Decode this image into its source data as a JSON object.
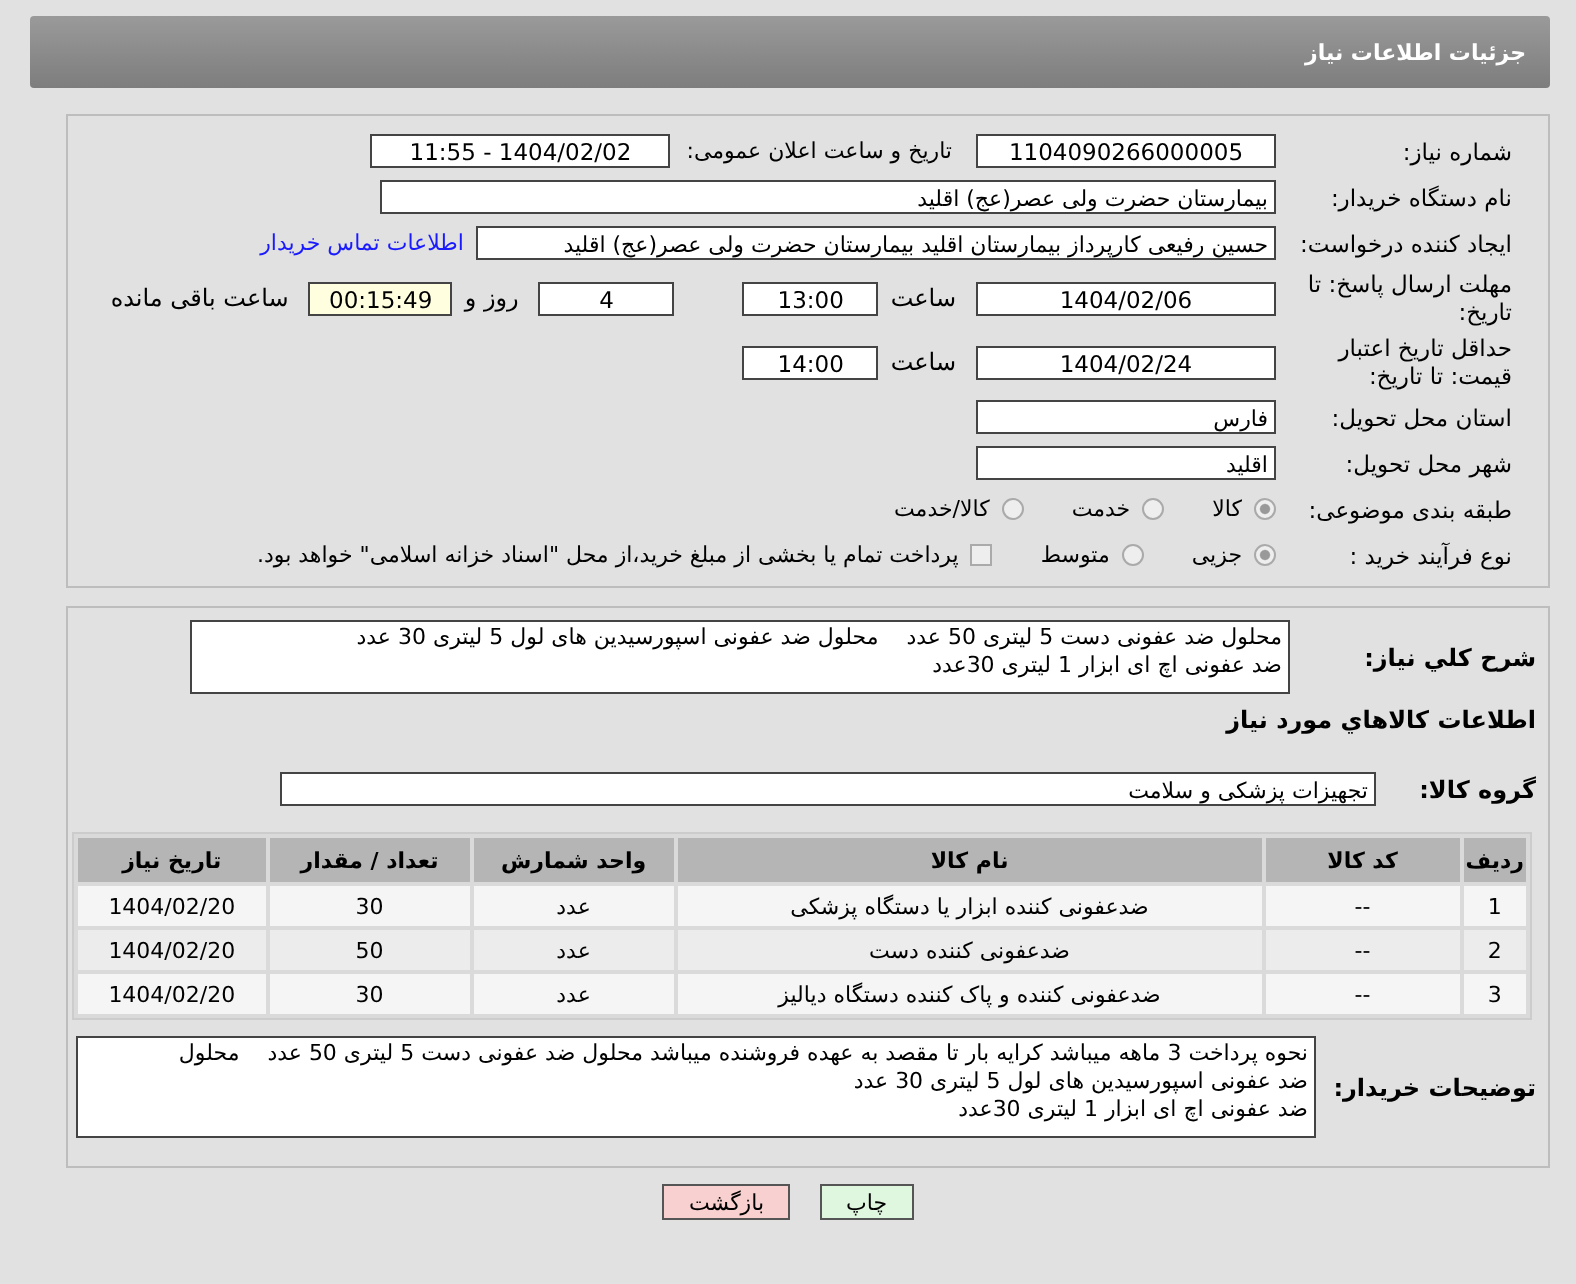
{
  "header": {
    "title": "جزئیات اطلاعات نیاز"
  },
  "details": {
    "need_number": {
      "label": "شماره نیاز:",
      "value": "1104090266000005"
    },
    "announce": {
      "label": "تاریخ و ساعت اعلان عمومی:",
      "value": "1404/02/02 - 11:55"
    },
    "buyer_org": {
      "label": "نام دستگاه خریدار:",
      "value": "بیمارستان حضرت ولی عصر(عج) اقلید"
    },
    "requester": {
      "label": "ایجاد کننده درخواست:",
      "value": "حسین رفیعی کارپرداز بیمارستان اقلید بیمارستان حضرت ولی عصر(عج) اقلید",
      "link": "اطلاعات تماس خریدار"
    },
    "deadline": {
      "label": "مهلت ارسال پاسخ: تا تاریخ:",
      "date": "1404/02/06",
      "time_label": "ساعت",
      "time": "13:00",
      "days": "4",
      "days_label": "روز و",
      "remaining": "00:15:49",
      "remaining_label": "ساعت باقی مانده"
    },
    "validity": {
      "label": "حداقل تاریخ اعتبار قیمت: تا تاریخ:",
      "date": "1404/02/24",
      "time_label": "ساعت",
      "time": "14:00"
    },
    "province": {
      "label": "استان محل تحویل:",
      "value": "فارس"
    },
    "city": {
      "label": "شهر محل تحویل:",
      "value": "اقلید"
    },
    "category": {
      "label": "طبقه بندی موضوعی:",
      "options": [
        {
          "label": "کالا",
          "selected": true
        },
        {
          "label": "خدمت",
          "selected": false
        },
        {
          "label": "کالا/خدمت",
          "selected": false
        }
      ]
    },
    "process": {
      "label": "نوع فرآیند خرید :",
      "options": [
        {
          "label": "جزیی",
          "selected": true
        },
        {
          "label": "متوسط",
          "selected": false
        }
      ],
      "treasury": {
        "checked": false,
        "label": "پرداخت تمام یا بخشی از مبلغ خرید،از محل \"اسناد خزانه اسلامی\" خواهد بود."
      }
    }
  },
  "needs": {
    "summary": {
      "label": "شرح کلي نياز:",
      "value": "محلول ضد عفونی دست 5 لیتری 50 عدد    محلول ضد عفونی اسپورسیدین های لول 5 لیتری 30 عدد\nضد عفونی اچ ای ابزار 1 لیتری 30عدد"
    },
    "section_title": "اطلاعات کالاهاي مورد نياز",
    "group": {
      "label": "گروه کالا:",
      "value": "تجهیزات پزشکی و سلامت"
    },
    "table": {
      "columns": [
        "ردیف",
        "کد کالا",
        "نام کالا",
        "واحد شمارش",
        "تعداد / مقدار",
        "تاریخ نیاز"
      ],
      "rows": [
        [
          "1",
          "--",
          "ضدعفونی کننده ابزار یا دستگاه پزشکی",
          "عدد",
          "30",
          "1404/02/20"
        ],
        [
          "2",
          "--",
          "ضدعفونی کننده دست",
          "عدد",
          "50",
          "1404/02/20"
        ],
        [
          "3",
          "--",
          "ضدعفونی کننده و پاک کننده دستگاه دیالیز",
          "عدد",
          "30",
          "1404/02/20"
        ]
      ]
    },
    "buyer_notes": {
      "label": "توضیحات خریدار:",
      "value": "نحوه پرداخت 3 ماهه میباشد کرایه بار تا مقصد به عهده فروشنده میباشد محلول ضد عفونی دست 5 لیتری 50 عدد    محلول\nضد عفونی اسپورسیدین های لول 5 لیتری 30 عدد\nضد عفونی اچ ای ابزار 1 لیتری 30عدد"
    }
  },
  "buttons": [
    {
      "label": "چاپ",
      "kind": "print"
    },
    {
      "label": "بازگشت",
      "kind": "back"
    }
  ]
}
